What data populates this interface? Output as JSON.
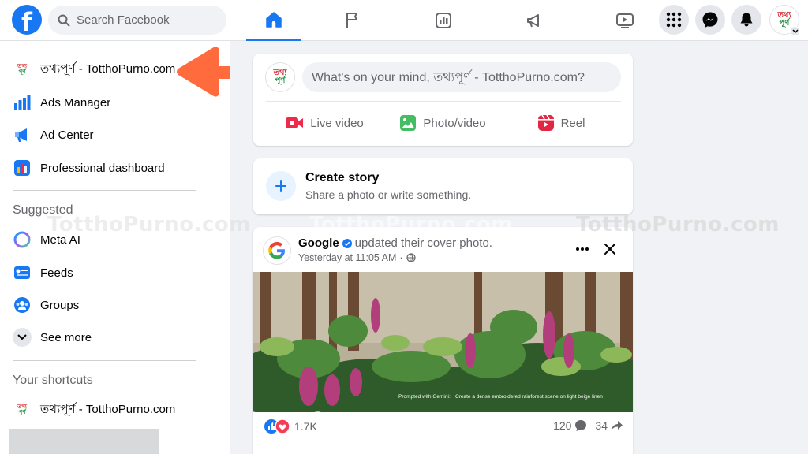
{
  "header": {
    "logo_letter": "f",
    "search_placeholder": "Search Facebook"
  },
  "page_logo": {
    "top": "তথ্য",
    "bottom": "পূর্ণ"
  },
  "sidebar": {
    "items": [
      {
        "label": "তথ্যপূর্ণ - TotthoPurno.com"
      },
      {
        "label": "Ads Manager"
      },
      {
        "label": "Ad Center"
      },
      {
        "label": "Professional dashboard"
      }
    ],
    "suggested_title": "Suggested",
    "suggested": [
      {
        "label": "Meta AI"
      },
      {
        "label": "Feeds"
      },
      {
        "label": "Groups"
      },
      {
        "label": "See more"
      }
    ],
    "shortcuts_title": "Your shortcuts",
    "shortcuts": [
      {
        "label": "তথ্যপূর্ণ - TotthoPurno.com"
      }
    ]
  },
  "composer": {
    "placeholder": "What's on your mind, তথ্যপূর্ণ - TotthoPurno.com?",
    "actions": [
      {
        "label": "Live video",
        "color": "#f02849"
      },
      {
        "label": "Photo/video",
        "color": "#45bd62"
      },
      {
        "label": "Reel",
        "color": "#e42645"
      }
    ]
  },
  "story": {
    "title": "Create story",
    "subtitle": "Share a photo or write something."
  },
  "post": {
    "author": "Google",
    "action": "updated their cover photo.",
    "time": "Yesterday at 11:05 AM",
    "separator": "·",
    "image_caption_prefix": "Prompted with Gemini:",
    "image_caption": "Create a dense embroidered rainforest scene on light beige linen",
    "reactions_count": "1.7K",
    "comments_count": "120",
    "shares_count": "34"
  },
  "watermark": "TotthoPurno.com",
  "colors": {
    "brand": "#1877f2",
    "arrow": "#ff6b3d"
  }
}
